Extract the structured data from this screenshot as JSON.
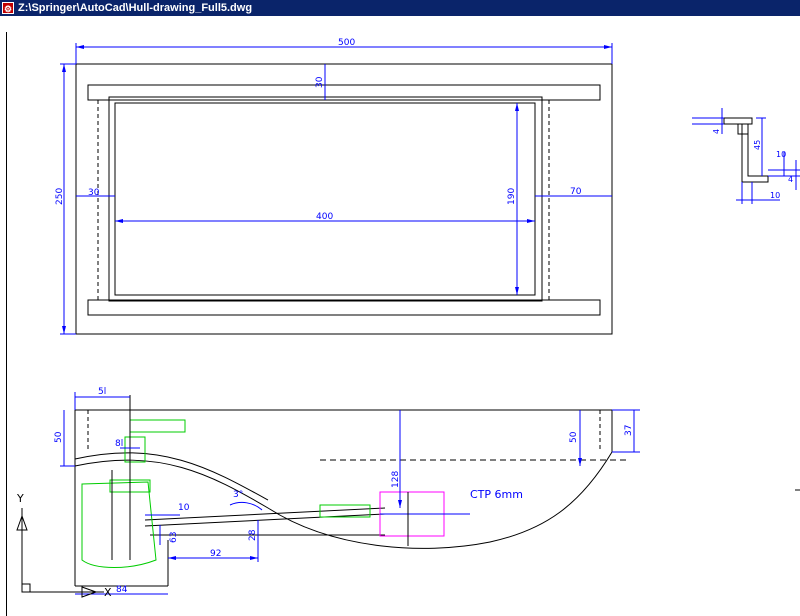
{
  "window": {
    "title": "Z:\\Springer\\AutoCad\\Hull-drawing_Full5.dwg",
    "icon": "autocad-app-icon"
  },
  "colors": {
    "dimension": "#0000ff",
    "geometry": "#000000",
    "component_green": "#00cc00",
    "component_magenta": "#ff00ff",
    "background": "#ffffff"
  },
  "drawing": {
    "top_view": {
      "dim_length": "500",
      "dim_width": "250",
      "dim_frame_offset": "30",
      "dim_side_offset": "30",
      "dim_inner_length": "400",
      "dim_inner_width": "190",
      "dim_right_offset": "70"
    },
    "detail_profile": {
      "dim_top_4": "4",
      "dim_height_45": "45",
      "dim_10_vertical": "10",
      "dim_4_right": "4",
      "dim_10_bottom": "10"
    },
    "side_view": {
      "dim_51": "5l",
      "dim_50_left": "50",
      "dim_8": "8l",
      "dim_10": "10",
      "dim_3deg": "3°",
      "dim_63": "63",
      "dim_28": "28",
      "dim_92": "92",
      "dim_128": "128",
      "dim_50_right": "50",
      "dim_37": "37",
      "dim_84": "84",
      "label_ctp": "CTP 6mm"
    },
    "ucs": {
      "x_label": "X",
      "y_label": "Y"
    }
  }
}
